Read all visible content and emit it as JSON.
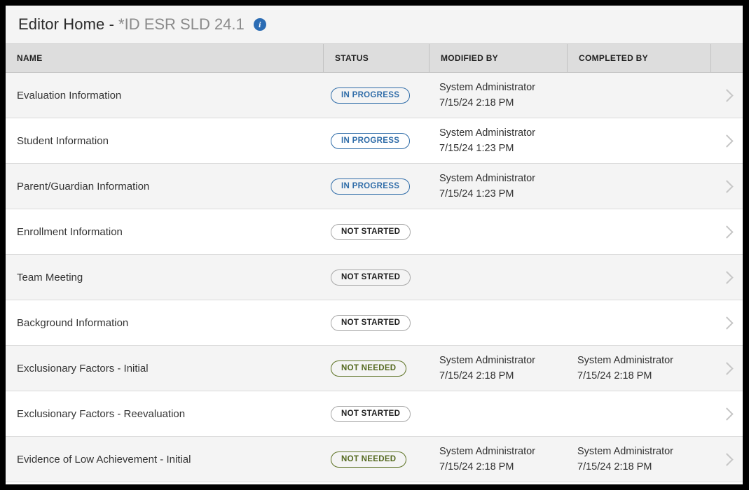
{
  "window": {
    "title_main": "Editor Home - ",
    "title_doc": "*ID ESR SLD 24.1",
    "info_icon_glyph": "i",
    "info_icon_name": "info-icon"
  },
  "colors": {
    "accent_blue": "#2f6ca8",
    "accent_green": "#54691f",
    "neutral_gray": "#a8a8a8",
    "info_badge_blue": "#2b6cb4",
    "title_bar_bg": "#f4f4f4",
    "header_row_bg": "#dddddd",
    "row_alt_bg": "#f4f4f4",
    "chevron_gray": "#c6c6c6"
  },
  "table": {
    "columns": [
      {
        "key": "name",
        "label": "NAME"
      },
      {
        "key": "status",
        "label": "STATUS"
      },
      {
        "key": "modified_by",
        "label": "MODIFIED BY"
      },
      {
        "key": "completed_by",
        "label": "COMPLETED BY"
      }
    ],
    "rows": [
      {
        "name": "Evaluation Information",
        "status": "IN PROGRESS",
        "status_type": "in-progress",
        "modified_by_user": "System Administrator",
        "modified_by_date": "7/15/24 2:18 PM",
        "completed_by_user": "",
        "completed_by_date": "",
        "chevron": "chevron-right-icon"
      },
      {
        "name": "Student Information",
        "status": "IN PROGRESS",
        "status_type": "in-progress",
        "modified_by_user": "System Administrator",
        "modified_by_date": "7/15/24 1:23 PM",
        "completed_by_user": "",
        "completed_by_date": "",
        "chevron": "chevron-right-icon"
      },
      {
        "name": "Parent/Guardian Information",
        "status": "IN PROGRESS",
        "status_type": "in-progress",
        "modified_by_user": "System Administrator",
        "modified_by_date": "7/15/24 1:23 PM",
        "completed_by_user": "",
        "completed_by_date": "",
        "chevron": "chevron-right-icon"
      },
      {
        "name": "Enrollment Information",
        "status": "NOT STARTED",
        "status_type": "not-started",
        "modified_by_user": "",
        "modified_by_date": "",
        "completed_by_user": "",
        "completed_by_date": "",
        "chevron": "chevron-right-icon"
      },
      {
        "name": "Team Meeting",
        "status": "NOT STARTED",
        "status_type": "not-started",
        "modified_by_user": "",
        "modified_by_date": "",
        "completed_by_user": "",
        "completed_by_date": "",
        "chevron": "chevron-right-icon"
      },
      {
        "name": "Background Information",
        "status": "NOT STARTED",
        "status_type": "not-started",
        "modified_by_user": "",
        "modified_by_date": "",
        "completed_by_user": "",
        "completed_by_date": "",
        "chevron": "chevron-right-icon"
      },
      {
        "name": "Exclusionary Factors - Initial",
        "status": "NOT NEEDED",
        "status_type": "not-needed",
        "modified_by_user": "System Administrator",
        "modified_by_date": "7/15/24 2:18 PM",
        "completed_by_user": "System Administrator",
        "completed_by_date": "7/15/24 2:18 PM",
        "chevron": "chevron-right-icon"
      },
      {
        "name": "Exclusionary Factors - Reevaluation",
        "status": "NOT STARTED",
        "status_type": "not-started",
        "modified_by_user": "",
        "modified_by_date": "",
        "completed_by_user": "",
        "completed_by_date": "",
        "chevron": "chevron-right-icon"
      },
      {
        "name": "Evidence of Low Achievement - Initial",
        "status": "NOT NEEDED",
        "status_type": "not-needed",
        "modified_by_user": "System Administrator",
        "modified_by_date": "7/15/24 2:18 PM",
        "completed_by_user": "System Administrator",
        "completed_by_date": "7/15/24 2:18 PM",
        "chevron": "chevron-right-icon"
      }
    ]
  }
}
